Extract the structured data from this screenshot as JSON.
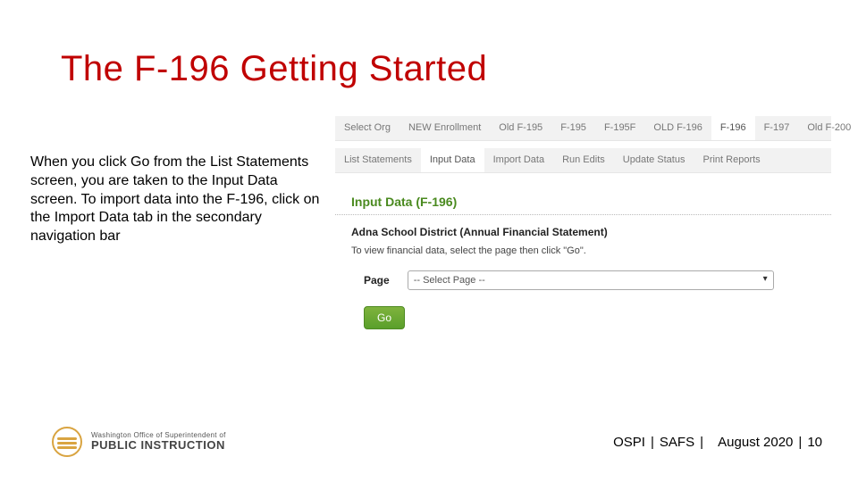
{
  "title": "The F-196 Getting Started",
  "body": "When you click Go from the List Statements screen, you are taken to the Input Data screen. To import data into the F-196, click on the Import Data tab in the secondary navigation bar",
  "app": {
    "primaryTabs": [
      "Select Org",
      "NEW Enrollment",
      "Old F-195",
      "F-195",
      "F-195F",
      "OLD F-196",
      "F-196",
      "F-197",
      "Old F-200"
    ],
    "primaryActiveIndex": 6,
    "secondaryTabs": [
      "List Statements",
      "Input Data",
      "Import Data",
      "Run Edits",
      "Update Status",
      "Print Reports"
    ],
    "secondaryActiveIndex": 1,
    "sectionTitle": "Input Data (F-196)",
    "district": "Adna School District (Annual Financial Statement)",
    "instruction": "To view financial data, select the page then click \"Go\".",
    "pageLabel": "Page",
    "selectPlaceholder": "-- Select Page --",
    "goLabel": "Go"
  },
  "footer": {
    "logoSmall": "Washington Office of Superintendent of",
    "logoBig": "PUBLIC INSTRUCTION",
    "org": "OSPI",
    "unit": "SAFS",
    "date": "August 2020",
    "page": "10",
    "sep": "|"
  }
}
